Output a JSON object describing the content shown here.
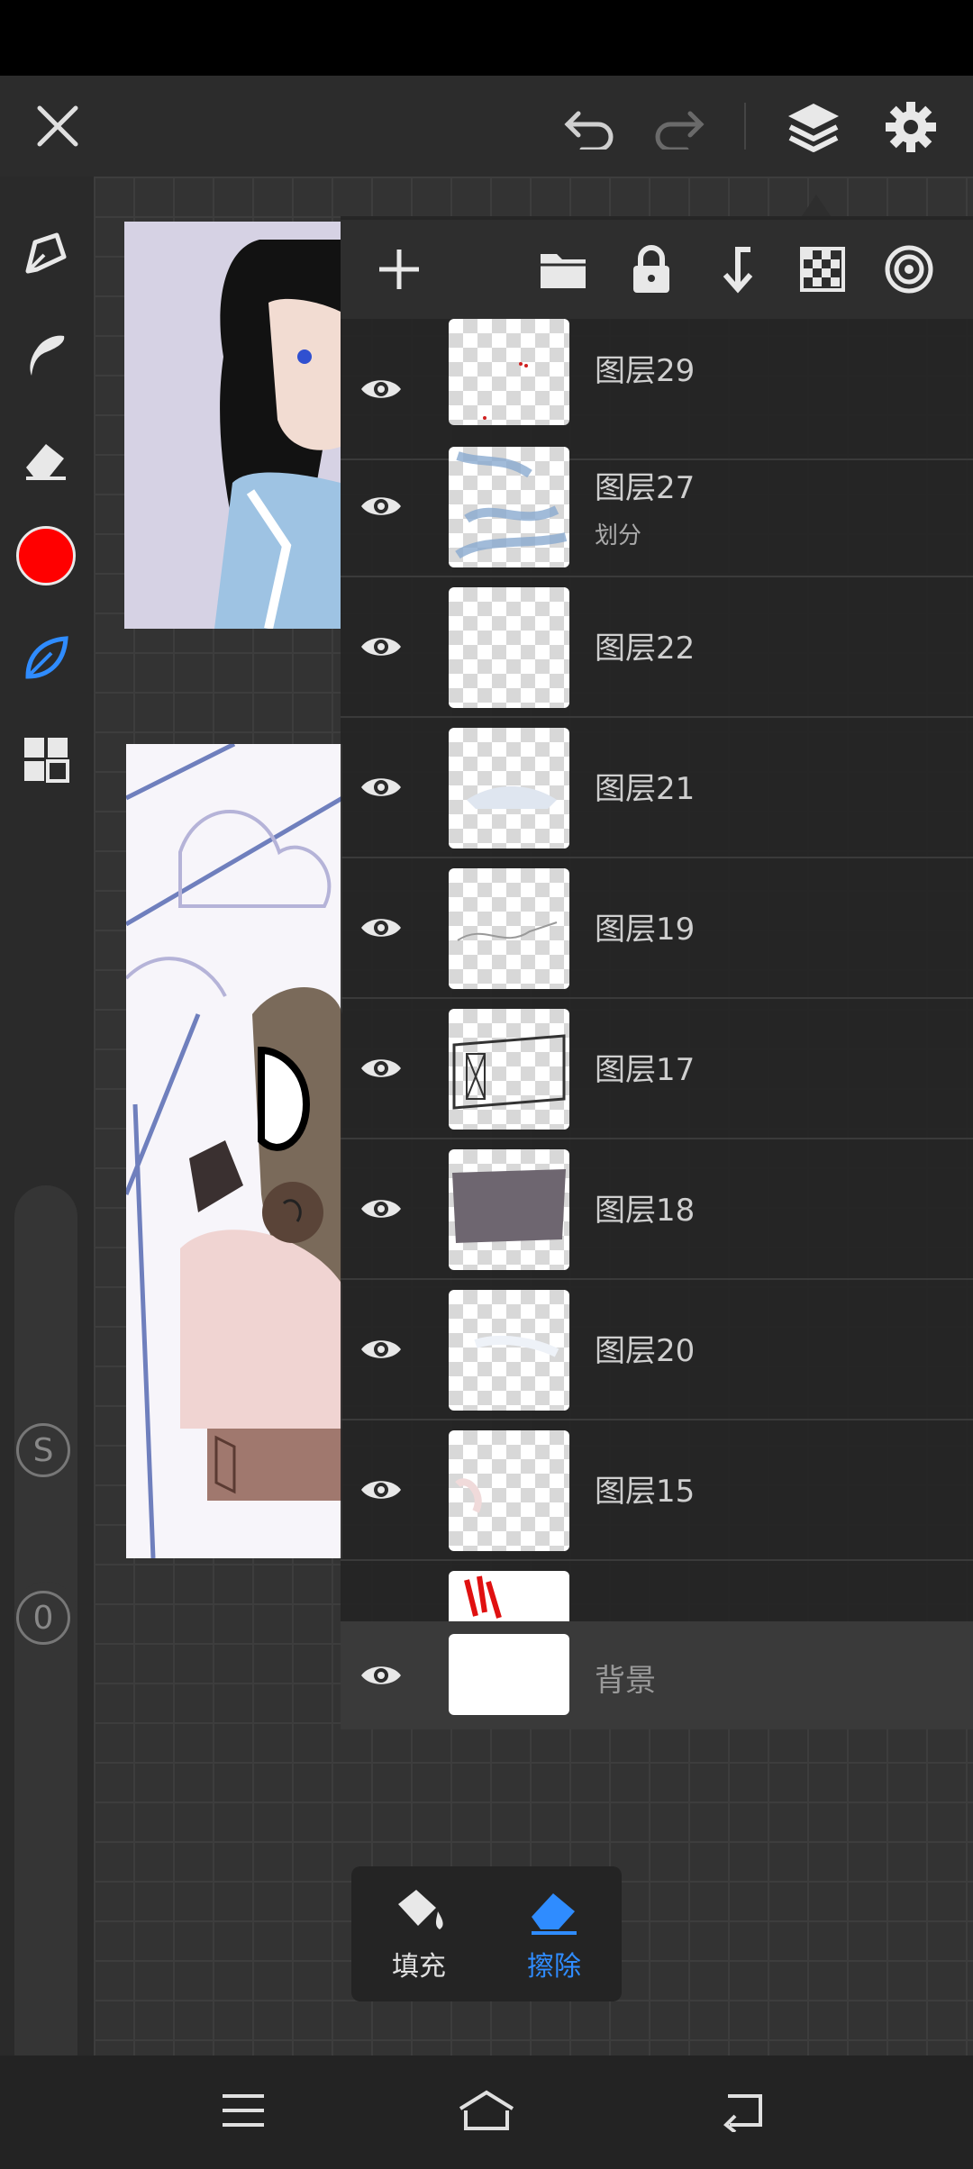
{
  "app": {
    "accent": "#2f8cff",
    "brush_color": "#ff0000"
  },
  "topbar": {
    "icons": [
      "close-icon",
      "undo-icon",
      "redo-icon",
      "layers-icon",
      "settings-icon"
    ]
  },
  "left_rail": {
    "tools": [
      "pen-icon",
      "smudge-icon",
      "eraser-icon",
      "color-swatch",
      "leaf-brush-icon",
      "grid-icon"
    ],
    "slider_top_label": "S",
    "slider_bottom_label": "0"
  },
  "layers_toolbar": {
    "icons": [
      "add-layer-icon",
      "folder-icon",
      "lock-icon",
      "merge-down-icon",
      "transparency-icon",
      "blend-target-icon"
    ]
  },
  "layers": [
    {
      "name": "图层29",
      "sub": ""
    },
    {
      "name": "图层27",
      "sub": "划分"
    },
    {
      "name": "图层22",
      "sub": ""
    },
    {
      "name": "图层21",
      "sub": ""
    },
    {
      "name": "图层19",
      "sub": ""
    },
    {
      "name": "图层17",
      "sub": ""
    },
    {
      "name": "图层18",
      "sub": ""
    },
    {
      "name": "图层20",
      "sub": ""
    },
    {
      "name": "图层15",
      "sub": ""
    }
  ],
  "background_layer": {
    "name": "背景"
  },
  "popup": {
    "fill_label": "填充",
    "erase_label": "擦除"
  },
  "navbar": {
    "icons": [
      "menu-icon",
      "home-icon",
      "back-icon"
    ]
  }
}
